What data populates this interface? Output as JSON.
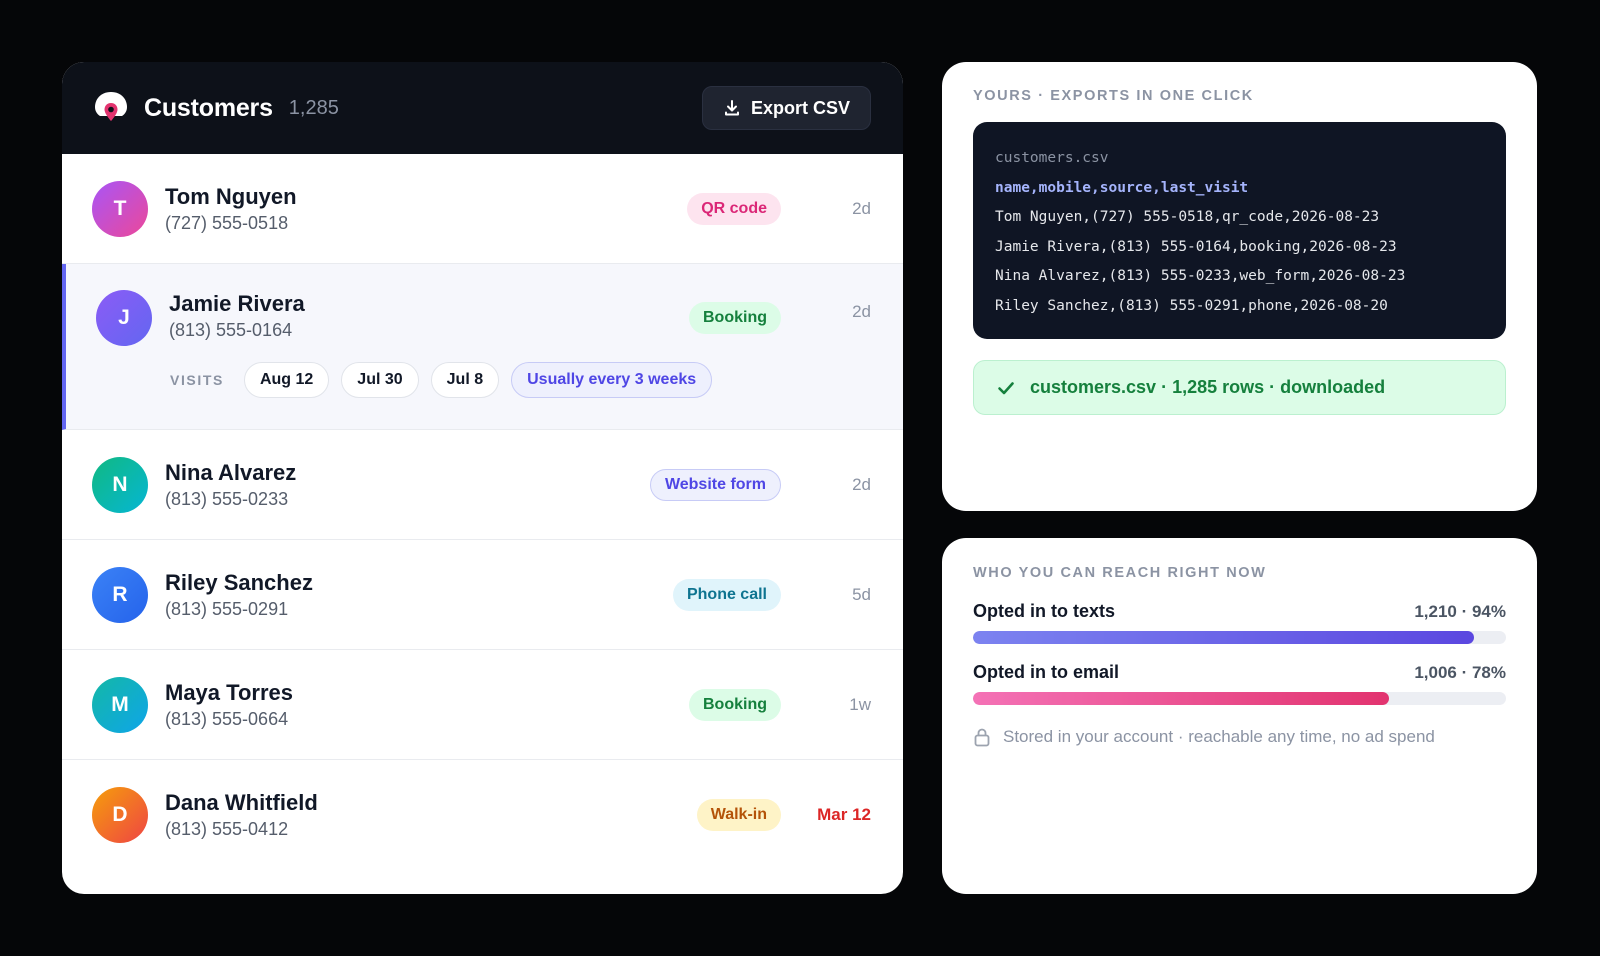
{
  "customers": {
    "title": "Customers",
    "count": "1,285",
    "export_label": "Export CSV",
    "visits_label": "VISITS",
    "rows": [
      {
        "initial": "T",
        "name": "Tom Nguyen",
        "phone": "(727) 555-0518",
        "source": "QR code",
        "time": "2d",
        "avatar_color": "#c74bd0"
      },
      {
        "initial": "J",
        "name": "Jamie Rivera",
        "phone": "(813) 555-0164",
        "source": "Booking",
        "time": "2d",
        "avatar_color": "#6d5ce8",
        "visits": [
          "Aug 12",
          "Jul 30",
          "Jul 8"
        ],
        "cadence": "Usually every 3 weeks"
      },
      {
        "initial": "N",
        "name": "Nina Alvarez",
        "phone": "(813) 555-0233",
        "source": "Website form",
        "time": "2d",
        "avatar_color": "#14b8a6"
      },
      {
        "initial": "R",
        "name": "Riley Sanchez",
        "phone": "(813) 555-0291",
        "source": "Phone call",
        "time": "5d",
        "avatar_color": "#3b82f6"
      },
      {
        "initial": "M",
        "name": "Maya Torres",
        "phone": "(813) 555-0664",
        "source": "Booking",
        "time": "1w",
        "avatar_color": "#0fb5c5"
      },
      {
        "initial": "D",
        "name": "Dana Whitfield",
        "phone": "(813) 555-0412",
        "source": "Walk-in",
        "time": "Mar 12",
        "avatar_color": "#f97316"
      }
    ]
  },
  "export": {
    "label": "YOURS · EXPORTS IN ONE CLICK",
    "filename": "customers.csv",
    "csv_header": "name,mobile,source,last_visit",
    "csv_lines": [
      "Tom Nguyen,(727) 555-0518,qr_code,2026-08-23",
      "Jamie Rivera,(813) 555-0164,booking,2026-08-23",
      "Nina Alvarez,(813) 555-0233,web_form,2026-08-23",
      "Riley Sanchez,(813) 555-0291,phone,2026-08-20"
    ],
    "status": "customers.csv · 1,285 rows · downloaded"
  },
  "reach": {
    "label": "WHO YOU CAN REACH RIGHT NOW",
    "texts": {
      "label": "Opted in to texts",
      "value": "1,210 · 94%",
      "percent": 94
    },
    "email": {
      "label": "Opted in to email",
      "value": "1,006 · 78%",
      "percent": 78
    },
    "note": "Stored in your account · reachable any time, no ad spend"
  },
  "colors": {
    "accent": "#6366f1",
    "badge_qr": "#db2777",
    "badge_booking": "#15803d",
    "badge_web": "#4f46e5",
    "badge_phone": "#0e7490",
    "badge_walkin": "#b45309",
    "alert": "#dc2626"
  }
}
